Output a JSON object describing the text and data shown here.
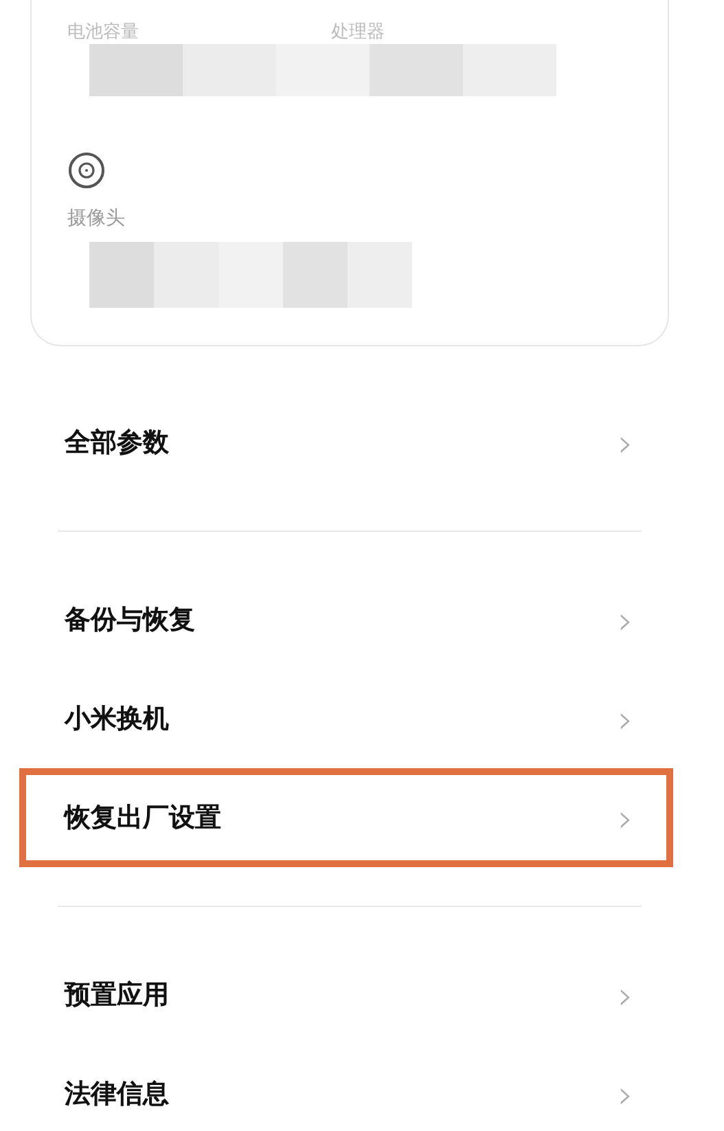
{
  "spec_card": {
    "specs": [
      {
        "label": "电池容量"
      },
      {
        "label": "处理器"
      }
    ],
    "camera": {
      "label": "摄像头"
    }
  },
  "groups": [
    {
      "items": [
        {
          "label": "全部参数",
          "chevron": "›",
          "highlighted": false
        }
      ]
    },
    {
      "items": [
        {
          "label": "备份与恢复",
          "chevron": "›",
          "highlighted": false
        },
        {
          "label": "小米换机",
          "chevron": "›",
          "highlighted": false
        },
        {
          "label": "恢复出厂设置",
          "chevron": "›",
          "highlighted": true
        }
      ]
    },
    {
      "items": [
        {
          "label": "预置应用",
          "chevron": "›",
          "highlighted": false
        },
        {
          "label": "法律信息",
          "chevron": "›",
          "highlighted": false
        }
      ]
    }
  ]
}
